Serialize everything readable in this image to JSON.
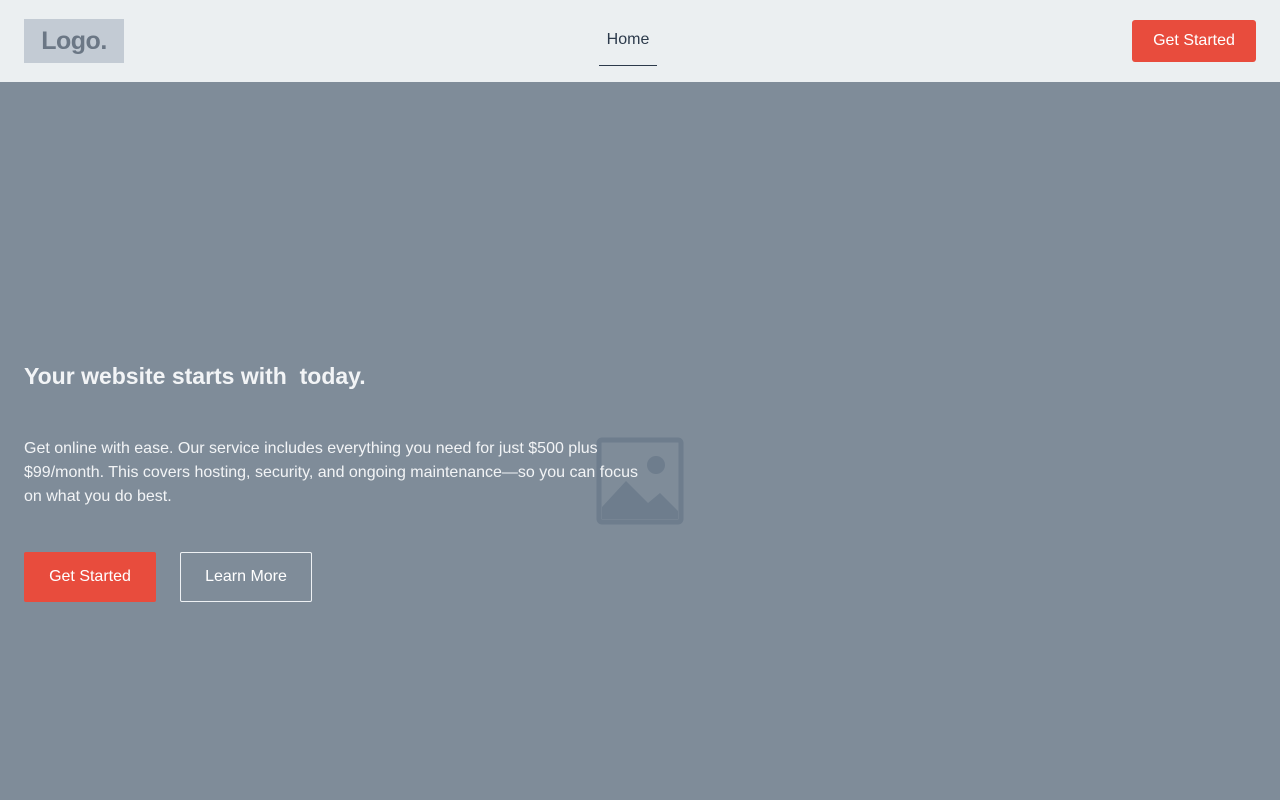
{
  "header": {
    "logo_text": "Logo.",
    "nav": [
      {
        "label": "Home",
        "active": true
      }
    ],
    "cta_label": "Get Started"
  },
  "hero": {
    "title": "Your website starts with  today.",
    "description": "Get online with ease. Our service includes everything you need for just $500 plus $99/month. This covers hosting, security, and ongoing maintenance—so you can focus on what you do best.",
    "primary_button": "Get Started",
    "secondary_button": "Learn More",
    "background_icon": "image-placeholder-icon"
  },
  "colors": {
    "header_bg": "#ebeff1",
    "hero_bg": "#7f8c99",
    "accent": "#e84c3d",
    "nav_text": "#2c3a4b"
  }
}
